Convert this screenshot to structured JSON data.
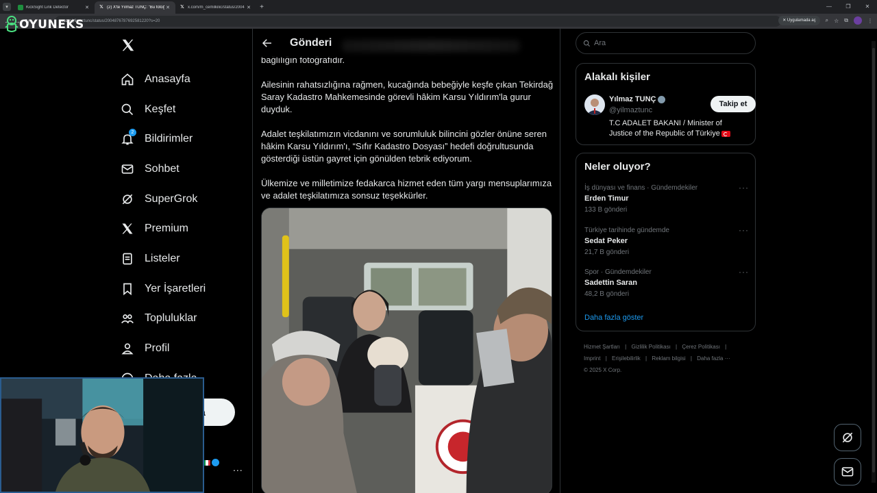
{
  "browser": {
    "tabs": [
      {
        "title": "KickSight Link Detector",
        "active": false
      },
      {
        "title": "(2) X'te Yılmaz TUNÇ: \"Bu fotoğ",
        "active": true
      },
      {
        "title": "x.com/m_cemilkilic/status/2004",
        "active": false
      }
    ],
    "url_host": "x.com",
    "url_path": "/yilmaztunc/status/2004876787692581220?s=20",
    "app_button": "Uygulamada aç"
  },
  "watermark": {
    "text": "OYUNEKS"
  },
  "nav": {
    "items": [
      {
        "label": "Anasayfa",
        "icon": "home-icon"
      },
      {
        "label": "Keşfet",
        "icon": "search-icon"
      },
      {
        "label": "Bildirimler",
        "icon": "bell-icon",
        "badge": "2"
      },
      {
        "label": "Sohbet",
        "icon": "mail-icon"
      },
      {
        "label": "SuperGrok",
        "icon": "grok-icon"
      },
      {
        "label": "Premium",
        "icon": "x-icon"
      },
      {
        "label": "Listeler",
        "icon": "list-icon"
      },
      {
        "label": "Yer İşaretleri",
        "icon": "bookmark-icon"
      },
      {
        "label": "Topluluklar",
        "icon": "people-icon"
      },
      {
        "label": "Profil",
        "icon": "person-icon"
      },
      {
        "label": "Daha fazla",
        "icon": "more-circle-icon"
      }
    ],
    "post_button": "a",
    "account_more": "..."
  },
  "post": {
    "header_title": "Gönderi",
    "paragraphs": [
      "bağlılığın fotoğrafıdır.",
      "Ailesinin rahatsızlığına rağmen, kucağında bebeğiyle keşfe çıkan Tekirdağ Saray Kadastro Mahkemesinde görevli hâkim Karsu Yıldırım'la gurur duyduk.",
      "Adalet teşkilatımızın vicdanını ve sorumluluk bilincini gözler önüne seren hâkim Karsu Yıldırım'ı, “Sıfır Kadastro Dosyası” hedefi doğrultusunda gösterdiği üstün gayret için gönülden tebrik ediyorum.",
      "Ülkemize ve milletimize fedakarca hizmet eden tüm yargı mensuplarımıza ve adalet teşkilatımıza sonsuz teşekkürler."
    ]
  },
  "sidebar": {
    "search_placeholder": "Ara",
    "related_title": "Alakalı kişiler",
    "person": {
      "name": "Yılmaz TUNÇ",
      "handle": "@yilmaztunc",
      "bio": "T.C ADALET BAKANI / Minister of Justice of the Republic of Türkiye",
      "follow_label": "Takip et"
    },
    "trends_title": "Neler oluyor?",
    "trends": [
      {
        "context": "İş dünyası ve finans · Gündemdekiler",
        "title": "Erden Timur",
        "count": "133 B gönderi"
      },
      {
        "context": "Türkiye tarihinde gündemde",
        "title": "Sedat Peker",
        "count": "21,7 B gönderi"
      },
      {
        "context": "Spor · Gündemdekiler",
        "title": "Sadettin Saran",
        "count": "48,2 B gönderi"
      }
    ],
    "show_more": "Daha fazla göster",
    "footer_line1": [
      "Hizmet Şartları",
      "|",
      "Gizlilik Politikası",
      "|",
      "Çerez Politikası",
      "|"
    ],
    "footer_line2": [
      "Imprint",
      "|",
      "Erişilebilirlik",
      "|",
      "Reklam bilgisi",
      "|",
      "Daha fazla ···"
    ],
    "copyright": "© 2025 X Corp."
  },
  "colors": {
    "accent": "#1d9bf0",
    "background": "#000000",
    "border": "#2f3336"
  }
}
